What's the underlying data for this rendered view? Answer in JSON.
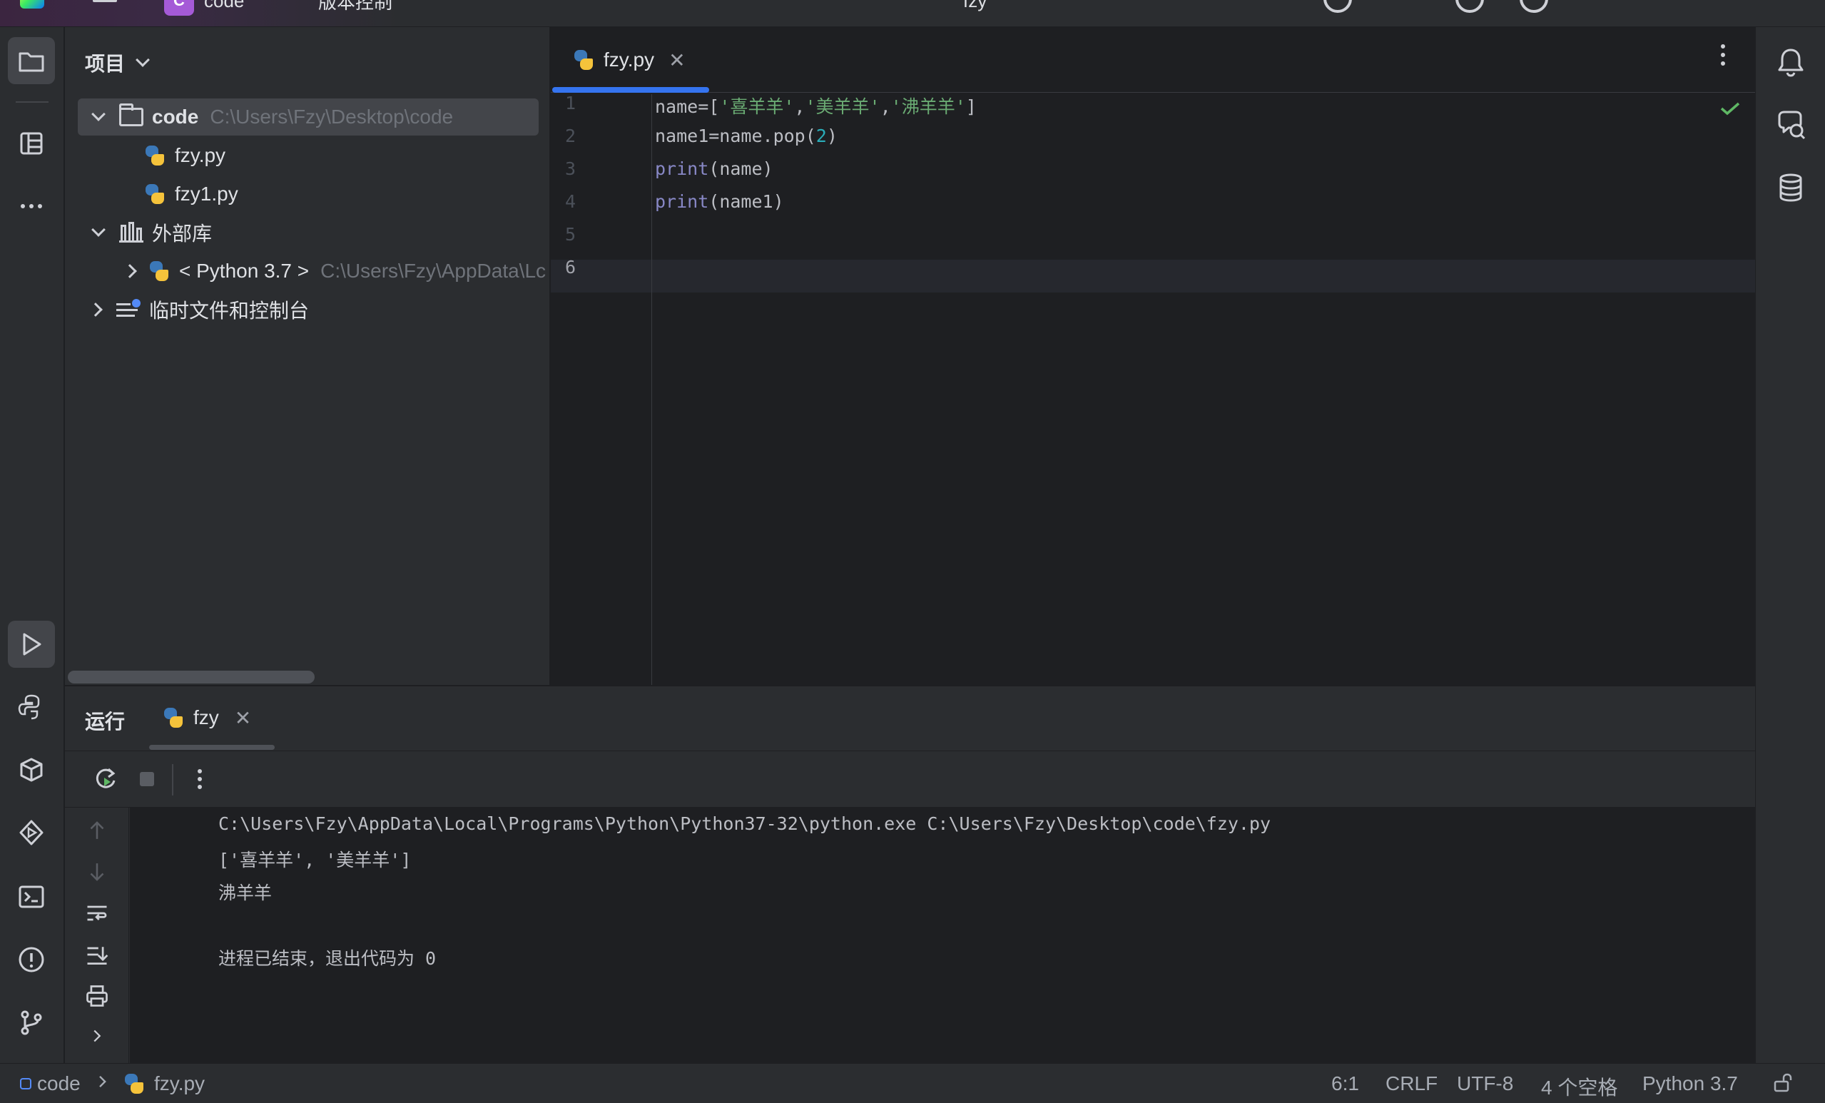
{
  "titlebar": {
    "project_badge": "C",
    "project_name": "code",
    "vcs_label": "版本控制",
    "run_config": "fzy"
  },
  "project_panel": {
    "title": "项目",
    "tree": [
      {
        "label": "code",
        "path": "C:\\Users\\Fzy\\Desktop\\code",
        "kind": "folder",
        "expanded": true
      },
      {
        "label": "fzy.py",
        "kind": "python-file"
      },
      {
        "label": "fzy1.py",
        "kind": "python-file"
      },
      {
        "label": "外部库",
        "kind": "library",
        "expanded": true
      },
      {
        "label": "< Python 3.7 >",
        "path": "C:\\Users\\Fzy\\AppData\\Lc",
        "kind": "python-sdk",
        "expanded": false
      },
      {
        "label": "临时文件和控制台",
        "kind": "scratches",
        "expanded": false
      }
    ]
  },
  "editor": {
    "tab_label": "fzy.py",
    "line_numbers": [
      "1",
      "2",
      "3",
      "4",
      "5",
      "6"
    ],
    "current_line": "6"
  },
  "run_panel": {
    "title": "运行",
    "tab_label": "fzy",
    "console": [
      "C:\\Users\\Fzy\\AppData\\Local\\Programs\\Python\\Python37-32\\python.exe C:\\Users\\Fzy\\Desktop\\code\\fzy.py",
      "['喜羊羊', '美羊羊']",
      "沸羊羊",
      "",
      "进程已结束，退出代码为 0"
    ]
  },
  "statusbar": {
    "breadcrumb_project": "code",
    "breadcrumb_file": "fzy.py",
    "caret": "6:1",
    "line_sep": "CRLF",
    "encoding": "UTF-8",
    "indent": "4 个空格",
    "interpreter": "Python 3.7"
  },
  "code": {
    "l1_a": "name=[",
    "l1_s1": "'喜羊羊'",
    "l1_c1": ",",
    "l1_s2": "'美羊羊'",
    "l1_c2": ",",
    "l1_s3": "'沸羊羊'",
    "l1_end": "]",
    "l2_a": "name1=name.pop(",
    "l2_num": "2",
    "l2_end": ")",
    "l3_fn": "print",
    "l3_rest": "(name)",
    "l4_fn": "print",
    "l4_rest": "(name1)"
  },
  "colors": {
    "accent": "#3574f0",
    "string": "#6aab73",
    "number": "#2aacb8",
    "builtin": "#8888c6",
    "background": "#1e1f22",
    "panel": "#2b2d30"
  },
  "icons": {
    "left_strip": [
      "project-folder-icon",
      "structure-icon",
      "more-icon",
      "run-icon",
      "python-console-icon",
      "python-packages-icon",
      "services-icon",
      "terminal-icon",
      "problems-icon",
      "git-icon"
    ],
    "right_strip": [
      "notifications-icon",
      "ai-assistant-icon",
      "database-icon"
    ]
  }
}
